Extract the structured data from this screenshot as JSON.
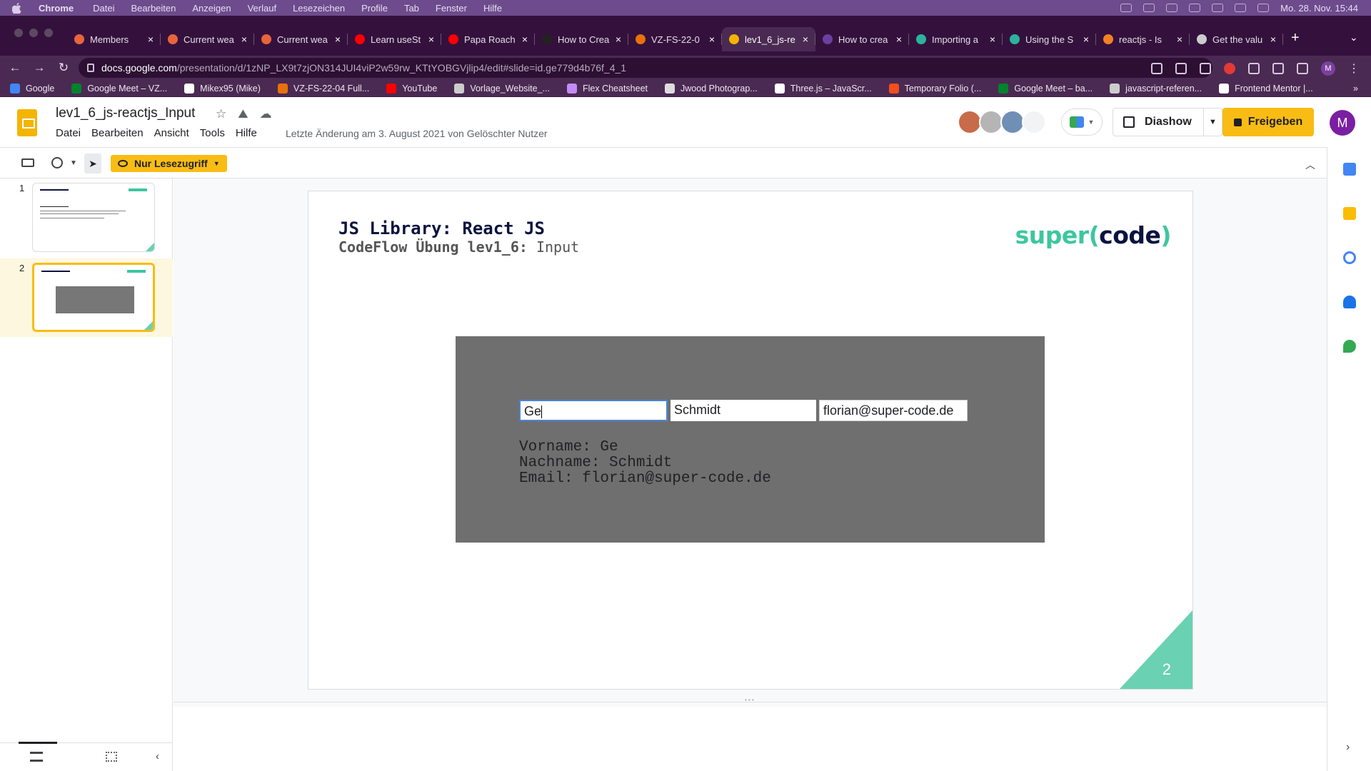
{
  "os_menu": {
    "app": "Chrome",
    "items": [
      "Datei",
      "Bearbeiten",
      "Anzeigen",
      "Verlauf",
      "Lesezeichen",
      "Profile",
      "Tab",
      "Fenster",
      "Hilfe"
    ],
    "clock": "Mo. 28. Nov.  15:44"
  },
  "browser": {
    "tabs": [
      {
        "label": "Members",
        "color": "#e8643c"
      },
      {
        "label": "Current wea",
        "color": "#e8643c"
      },
      {
        "label": "Current wea",
        "color": "#e8643c"
      },
      {
        "label": "Learn useSt",
        "color": "#ff0000"
      },
      {
        "label": "Papa Roach",
        "color": "#ff0000"
      },
      {
        "label": "How to Crea",
        "color": "#222222"
      },
      {
        "label": "VZ-FS-22-0",
        "color": "#e8710a"
      },
      {
        "label": "lev1_6_js-re",
        "color": "#f4b400"
      },
      {
        "label": "How to crea",
        "color": "#6b3fa0"
      },
      {
        "label": "Importing a",
        "color": "#2bb3a0"
      },
      {
        "label": "Using the S",
        "color": "#2bb3a0"
      },
      {
        "label": "reactjs - Is",
        "color": "#f48024"
      },
      {
        "label": "Get the valu",
        "color": "#cccccc"
      }
    ],
    "url_host": "docs.google.com",
    "url_path": "/presentation/d/1zNP_LX9t7zjON314JUI4viP2w59rw_KTtYOBGVjlip4/edit#slide=id.ge779d4b76f_4_1",
    "profile_initial": "M",
    "bookmarks": [
      {
        "label": "Google",
        "color": "#4285f4"
      },
      {
        "label": "Google Meet – VZ...",
        "color": "#00832d"
      },
      {
        "label": "Mikex95 (Mike)",
        "color": "#ffffff"
      },
      {
        "label": "VZ-FS-22-04 Full...",
        "color": "#e8710a"
      },
      {
        "label": "YouTube",
        "color": "#ff0000"
      },
      {
        "label": "Vorlage_Website_...",
        "color": "#cccccc"
      },
      {
        "label": "Flex Cheatsheet",
        "color": "#c58af9"
      },
      {
        "label": "Jwood Photograp...",
        "color": "#dddddd"
      },
      {
        "label": "Three.js – JavaScr...",
        "color": "#ffffff"
      },
      {
        "label": "Temporary Folio (...",
        "color": "#f24e1e"
      },
      {
        "label": "Google Meet – ba...",
        "color": "#00832d"
      },
      {
        "label": "javascript-referen...",
        "color": "#cccccc"
      },
      {
        "label": "Frontend Mentor |...",
        "color": "#ffffff"
      }
    ]
  },
  "doc": {
    "title": "lev1_6_js-reactjs_Input",
    "menu": [
      "Datei",
      "Bearbeiten",
      "Ansicht",
      "Tools",
      "Hilfe"
    ],
    "last_edit": "Letzte Änderung am 3. August 2021 von Gelöschter Nutzer",
    "present_label": "Diashow",
    "share_label": "Freigeben",
    "user_initial": "M",
    "readonly_label": "Nur Lesezugriff"
  },
  "filmstrip": {
    "slides": [
      {
        "num": "1"
      },
      {
        "num": "2"
      }
    ]
  },
  "slide": {
    "title": "JS Library: React JS",
    "subtitle_bold": "CodeFlow Übung lev1_6:",
    "subtitle_rest": " Input",
    "logo_a": "super(",
    "logo_b": "code",
    "logo_c": ")",
    "page_number": "2",
    "screenshot": {
      "field_vorname": "Ge",
      "field_nachname": "Schmidt",
      "field_email": "florian@super-code.de",
      "out_vorname": "Vorname: Ge",
      "out_nachname": "Nachname: Schmidt",
      "out_email": "Email: florian@super-code.de"
    }
  },
  "colors": {
    "accent_yellow": "#f9bc15",
    "logo_teal": "#3ec6a0",
    "title_navy": "#0b1340",
    "browser_purple": "#4a2a52"
  }
}
